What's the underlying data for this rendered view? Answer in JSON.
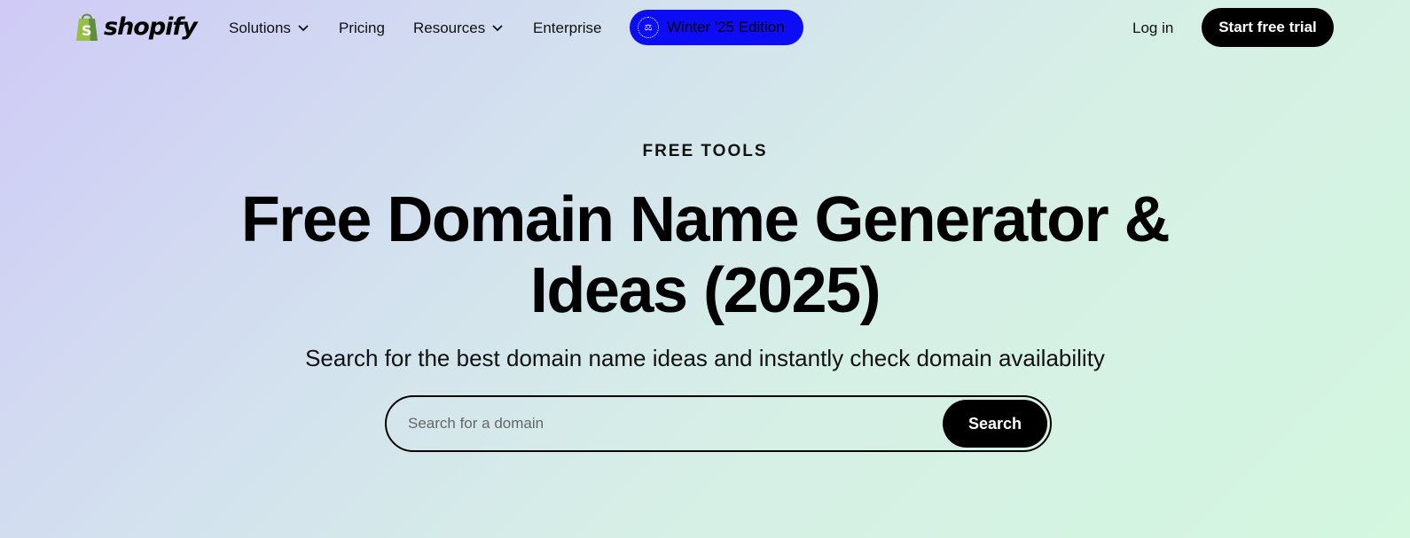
{
  "brand": {
    "name": "shopify",
    "logo_icon": "shopping-bag-icon",
    "logo_color": "#95bf47"
  },
  "nav": {
    "items": [
      {
        "label": "Solutions",
        "has_dropdown": true
      },
      {
        "label": "Pricing",
        "has_dropdown": false
      },
      {
        "label": "Resources",
        "has_dropdown": true
      },
      {
        "label": "Enterprise",
        "has_dropdown": false
      }
    ],
    "badge": {
      "label": "Winter '25 Edition",
      "color": "#0d0df5"
    },
    "login": "Log in",
    "cta": "Start free trial"
  },
  "hero": {
    "eyebrow": "FREE TOOLS",
    "title": "Free Domain Name Generator & Ideas (2025)",
    "subtitle": "Search for the best domain name ideas and instantly check domain availability"
  },
  "search": {
    "placeholder": "Search for a domain",
    "value": "",
    "button_label": "Search"
  }
}
